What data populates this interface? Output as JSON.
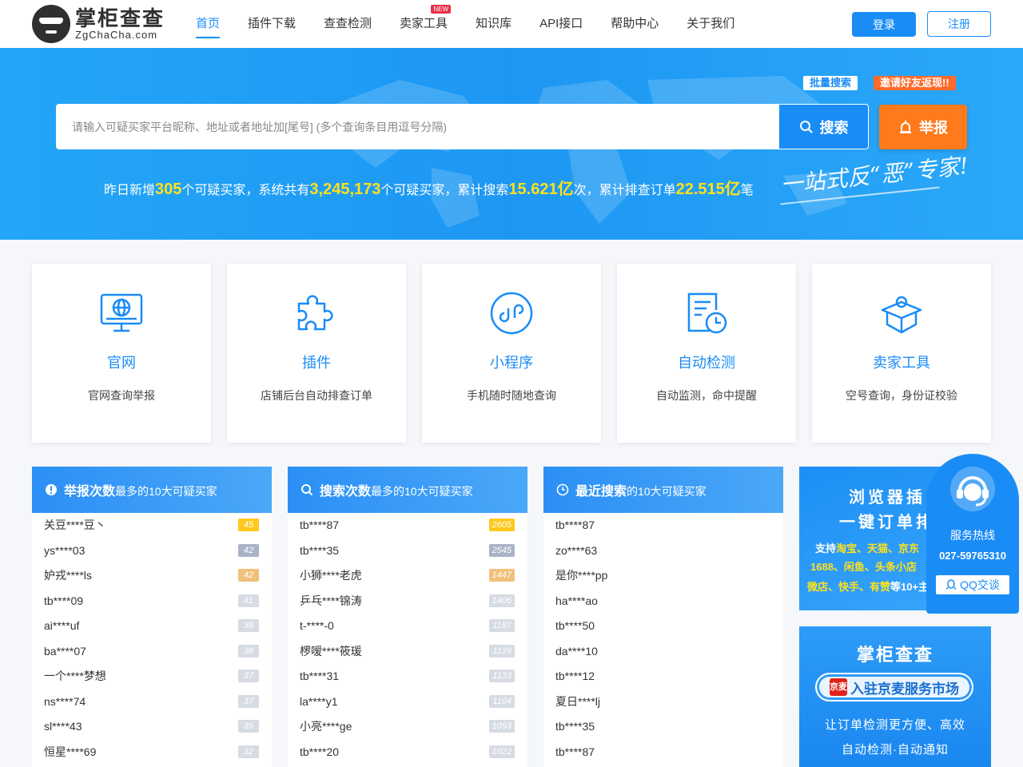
{
  "header": {
    "logo_cn": "掌柜查查",
    "logo_en": "ZgChaCha.com",
    "nav": [
      {
        "label": "首页",
        "active": true
      },
      {
        "label": "插件下载"
      },
      {
        "label": "查查检测"
      },
      {
        "label": "卖家工具",
        "badge": "NEW"
      },
      {
        "label": "知识库"
      },
      {
        "label": "API接口"
      },
      {
        "label": "帮助中心"
      },
      {
        "label": "关于我们"
      }
    ],
    "login_label": "登录",
    "register_label": "注册"
  },
  "banner": {
    "batch_search": "批量搜索",
    "invite": "邀请好友返现!!",
    "search_placeholder": "请输入可疑买家平台昵称、地址或者地址加[尾号] (多个查询条目用逗号分隔)",
    "search_label": "搜索",
    "report_label": "举报",
    "stats": {
      "t1": "昨日新增",
      "n1": "305",
      "t2": "个可疑买家，系统共有",
      "n2": "3,245,173",
      "t3": "个可疑买家，累计搜索",
      "n3": "15.621亿",
      "t4": "次，累计排查订单",
      "n4": "22.515亿",
      "t5": "笔"
    },
    "slogan": "一站式反“恶”专家!"
  },
  "features": [
    {
      "title": "官网",
      "desc": "官网查询举报",
      "icon": "monitor-globe-icon"
    },
    {
      "title": "插件",
      "desc": "店铺后台自动排查订单",
      "icon": "puzzle-icon"
    },
    {
      "title": "小程序",
      "desc": "手机随时随地查询",
      "icon": "mini-program-icon"
    },
    {
      "title": "自动检测",
      "desc": "自动监测，命中提醒",
      "icon": "document-clock-icon"
    },
    {
      "title": "卖家工具",
      "desc": "空号查询，身份证校验",
      "icon": "toolbox-icon"
    }
  ],
  "lists": [
    {
      "bold": "举报次数",
      "rest": "最多的10大可疑买家",
      "icon": "alert-icon",
      "rows": [
        {
          "name": "关豆****豆丶",
          "count": "45"
        },
        {
          "name": "ys****03",
          "count": "42"
        },
        {
          "name": "妒戎****ls",
          "count": "42"
        },
        {
          "name": "tb****09",
          "count": "41"
        },
        {
          "name": "ai****uf",
          "count": "38"
        },
        {
          "name": "ba****07",
          "count": "38"
        },
        {
          "name": "一个****梦想",
          "count": "37"
        },
        {
          "name": "ns****74",
          "count": "37"
        },
        {
          "name": "sl****43",
          "count": "35"
        },
        {
          "name": "恒星****69",
          "count": "32"
        }
      ]
    },
    {
      "bold": "搜索次数",
      "rest": "最多的10大可疑买家",
      "icon": "search-icon",
      "rows": [
        {
          "name": "tb****87",
          "count": "2605"
        },
        {
          "name": "tb****35",
          "count": "2545"
        },
        {
          "name": "小狮****老虎",
          "count": "1447"
        },
        {
          "name": "乒乓****锦涛",
          "count": "1406"
        },
        {
          "name": "t-****-0",
          "count": "1187"
        },
        {
          "name": "椤嗳****筱瑗",
          "count": "1139"
        },
        {
          "name": "tb****31",
          "count": "1133"
        },
        {
          "name": "la****y1",
          "count": "1104"
        },
        {
          "name": "小亮****ge",
          "count": "1093"
        },
        {
          "name": "tb****20",
          "count": "1022"
        }
      ]
    },
    {
      "bold": "最近搜索",
      "rest": "的10大可疑买家",
      "icon": "clock-icon",
      "rows": [
        {
          "name": "tb****87"
        },
        {
          "name": "zo****63"
        },
        {
          "name": "是你****pp"
        },
        {
          "name": "ha****ao"
        },
        {
          "name": "tb****50"
        },
        {
          "name": "da****10"
        },
        {
          "name": "tb****12"
        },
        {
          "name": "夏日****lj"
        },
        {
          "name": "tb****35"
        },
        {
          "name": "tb****87"
        }
      ]
    }
  ],
  "ad1": {
    "line1": "浏览器插",
    "line2": "一键订单排",
    "line3a": "支持",
    "line3b": "淘宝、天猫、京东",
    "line4": "1688、闲鱼、头条小店",
    "line5a": "微店、快手、有赞",
    "line5b": "等10+主"
  },
  "ad2": {
    "title": "掌柜查查",
    "jd_logo": "京麦",
    "pill": "入驻京麦服务市场",
    "line1": "让订单检测更方便、高效",
    "line2": "自动检测·自动通知"
  },
  "service": {
    "label": "服务热线",
    "phone": "027-59765310",
    "qq": "QQ交谈"
  },
  "colors": {
    "primary": "#1a8cf6",
    "accent": "#ff7a1a",
    "highlight": "#ffe11a",
    "rank_gold": "#ffc81e",
    "rank_silver": "#a9b3c8",
    "rank_bronze": "#f1c07a",
    "rank_other": "#d6dbe4"
  }
}
